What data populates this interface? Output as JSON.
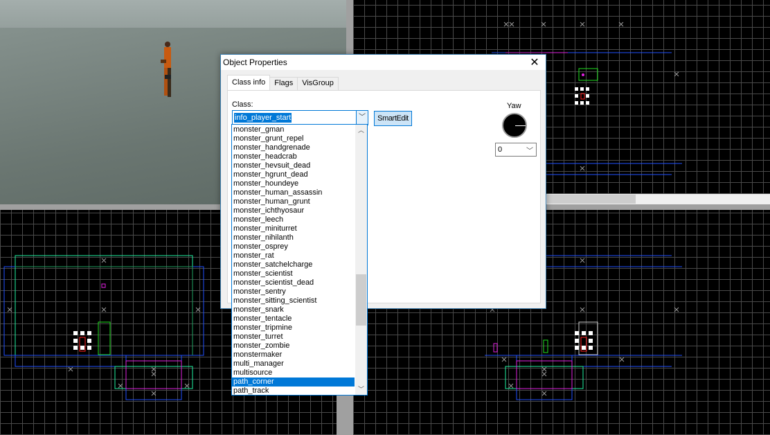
{
  "dialog": {
    "title": "Object Properties",
    "close_icon": "close-icon",
    "tabs": [
      {
        "label": "Class info",
        "active": true
      },
      {
        "label": "Flags"
      },
      {
        "label": "VisGroup"
      }
    ],
    "class_label": "Class:",
    "class_value": "info_player_start",
    "smartedit_label": "SmartEdit",
    "yaw_label": "Yaw",
    "yaw_value": "0",
    "class_list": [
      "monster_gman",
      "monster_grunt_repel",
      "monster_handgrenade",
      "monster_headcrab",
      "monster_hevsuit_dead",
      "monster_hgrunt_dead",
      "monster_houndeye",
      "monster_human_assassin",
      "monster_human_grunt",
      "monster_ichthyosaur",
      "monster_leech",
      "monster_miniturret",
      "monster_nihilanth",
      "monster_osprey",
      "monster_rat",
      "monster_satchelcharge",
      "monster_scientist",
      "monster_scientist_dead",
      "monster_sentry",
      "monster_sitting_scientist",
      "monster_snark",
      "monster_tentacle",
      "monster_tripmine",
      "monster_turret",
      "monster_zombie",
      "monstermaker",
      "multi_manager",
      "multisource",
      "path_corner",
      "path_track"
    ],
    "selected_item": "path_corner"
  },
  "colors": {
    "accent": "#0078d7",
    "grid": "#4a4a4a",
    "brush_blue": "#2050ff",
    "brush_green": "#20e0a0",
    "brush_magenta": "#e020e0",
    "entity_red": "#ff2020"
  }
}
